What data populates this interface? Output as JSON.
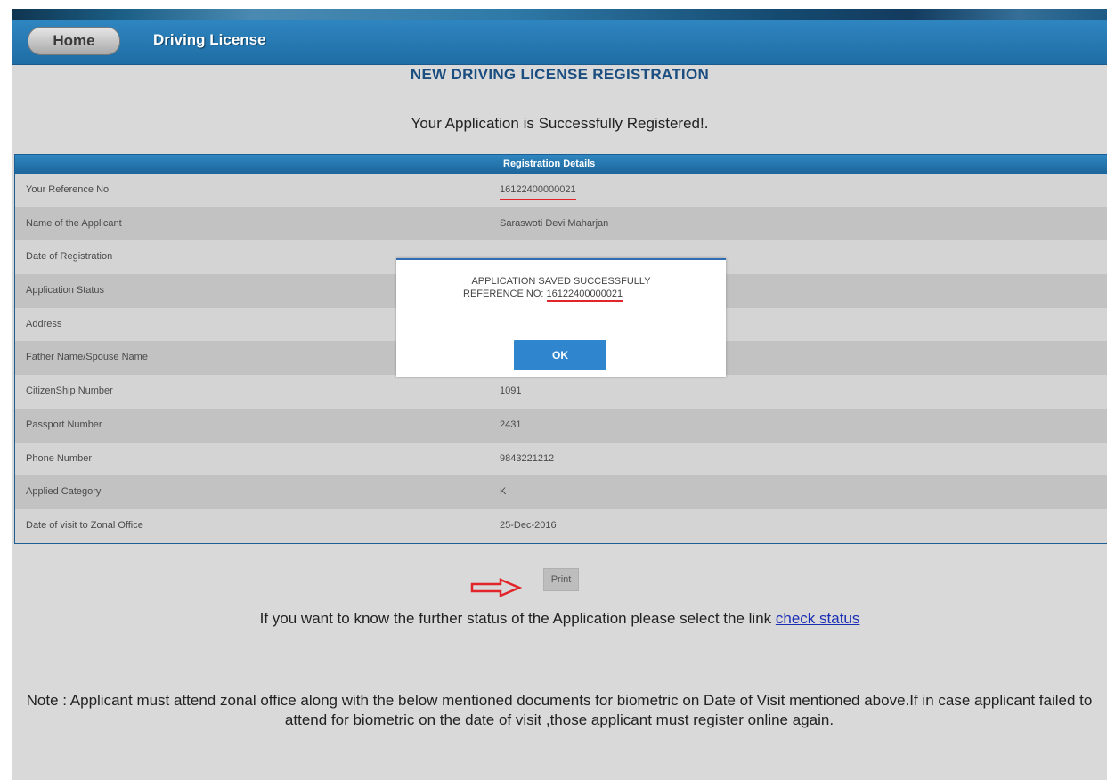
{
  "nav": {
    "home_label": "Home",
    "driving_license_label": "Driving License"
  },
  "page": {
    "title": "NEW DRIVING LICENSE REGISTRATION",
    "success_message": "Your Application is Successfully Registered!."
  },
  "details": {
    "header": "Registration Details",
    "rows": [
      {
        "label": "Your Reference No",
        "value": "16122400000021"
      },
      {
        "label": "Name of the Applicant",
        "value": "Saraswoti Devi Maharjan"
      },
      {
        "label": "Date of Registration",
        "value": ""
      },
      {
        "label": "Application Status",
        "value": ""
      },
      {
        "label": "Address",
        "value": ""
      },
      {
        "label": "Father Name/Spouse Name",
        "value": ""
      },
      {
        "label": "CitizenShip Number",
        "value": "1091"
      },
      {
        "label": "Passport Number",
        "value": "2431"
      },
      {
        "label": "Phone Number",
        "value": "9843221212"
      },
      {
        "label": "Applied Category",
        "value": "K"
      },
      {
        "label": "Date of visit to Zonal Office",
        "value": "25-Dec-2016"
      }
    ]
  },
  "print_label": "Print",
  "status": {
    "text": "If you want to know the further status of the Application please select the link ",
    "link_label": "check status"
  },
  "note_text": "Note : Applicant must attend zonal office along with the below mentioned documents for biometric on Date of Visit mentioned above.If in case applicant failed to attend for biometric on the date of visit ,those applicant must register online again.",
  "modal": {
    "line1": "APPLICATION SAVED SUCCESSFULLY",
    "ref_prefix": "REFERENCE NO: ",
    "ref_number": "16122400000021",
    "ok_label": "OK"
  },
  "colors": {
    "navbar": "#1f6da5",
    "annotation_red": "#e0262b",
    "link": "#1a2eb5"
  },
  "icons": {
    "print_pointer": "right-arrow-outline"
  }
}
